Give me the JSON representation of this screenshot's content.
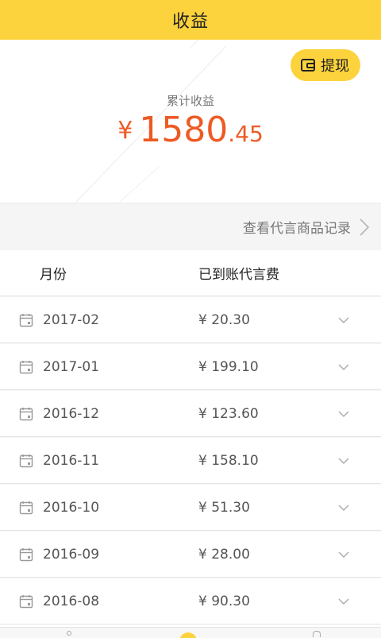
{
  "header": {
    "title": "收益"
  },
  "summary": {
    "withdraw_label": "提现",
    "total_label": "累计收益",
    "currency": "¥",
    "total_int": "1580",
    "total_dec": ".45"
  },
  "record_link": {
    "label": "查看代言商品记录"
  },
  "table": {
    "headers": {
      "month": "月份",
      "amount": "已到账代言费"
    },
    "rows": [
      {
        "month": "2017-02",
        "amount": "¥ 20.30"
      },
      {
        "month": "2017-01",
        "amount": "¥ 199.10"
      },
      {
        "month": "2016-12",
        "amount": "¥ 123.60"
      },
      {
        "month": "2016-11",
        "amount": "¥ 158.10"
      },
      {
        "month": "2016-10",
        "amount": "¥ 51.30"
      },
      {
        "month": "2016-09",
        "amount": "¥ 28.00"
      },
      {
        "month": "2016-08",
        "amount": "¥ 90.30"
      }
    ]
  },
  "colors": {
    "accent": "#fcd33c",
    "amount": "#ee5a24"
  }
}
